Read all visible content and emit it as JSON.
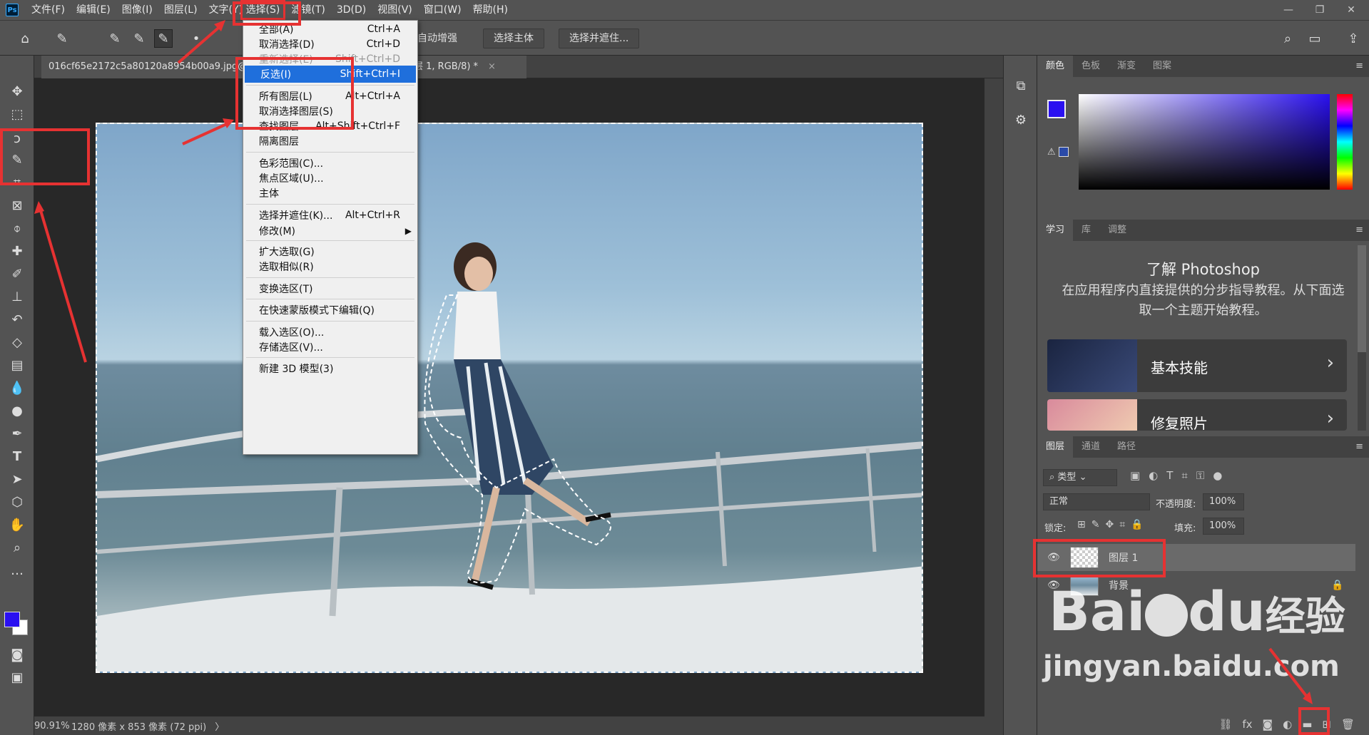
{
  "menubar": {
    "logo": "Ps",
    "items": [
      "文件(F)",
      "编辑(E)",
      "图像(I)",
      "图层(L)",
      "文字(Y)",
      "选择(S)",
      "滤镜(T)",
      "3D(D)",
      "视图(V)",
      "窗口(W)",
      "帮助(H)"
    ],
    "window_controls": [
      "—",
      "❐",
      "✕"
    ]
  },
  "options_bar": {
    "auto_enhance": "自动增强",
    "select_subject": "选择主体",
    "select_and_mask": "选择并遮住..."
  },
  "document": {
    "tab_label": "016cf65e2172c5a80120a8954b00a9.jpg@",
    "tab_suffix": "层 1, RGB/8) *",
    "tab_close": "×"
  },
  "status": {
    "zoom": "90.91%",
    "size": "1280 像素 x 853 像素 (72 ppi)",
    "arrow": "〉"
  },
  "select_menu": {
    "items": [
      {
        "label": "全部(A)",
        "shortcut": "Ctrl+A",
        "state": "normal"
      },
      {
        "label": "取消选择(D)",
        "shortcut": "Ctrl+D",
        "state": "normal"
      },
      {
        "label": "重新选择(E)",
        "shortcut": "Shift+Ctrl+D",
        "state": "disabled"
      },
      {
        "label": "反选(I)",
        "shortcut": "Shift+Ctrl+I",
        "state": "highlighted"
      },
      {
        "label": "所有图层(L)",
        "shortcut": "Alt+Ctrl+A",
        "state": "normal"
      },
      {
        "label": "取消选择图层(S)",
        "shortcut": "",
        "state": "normal"
      },
      {
        "label": "查找图层",
        "shortcut": "Alt+Shift+Ctrl+F",
        "state": "normal"
      },
      {
        "label": "隔离图层",
        "shortcut": "",
        "state": "normal"
      },
      {
        "label": "色彩范围(C)...",
        "shortcut": "",
        "state": "normal"
      },
      {
        "label": "焦点区域(U)...",
        "shortcut": "",
        "state": "normal"
      },
      {
        "label": "主体",
        "shortcut": "",
        "state": "normal"
      },
      {
        "label": "选择并遮住(K)...",
        "shortcut": "Alt+Ctrl+R",
        "state": "normal"
      },
      {
        "label": "修改(M)",
        "shortcut": "",
        "state": "submenu"
      },
      {
        "label": "扩大选取(G)",
        "shortcut": "",
        "state": "normal"
      },
      {
        "label": "选取相似(R)",
        "shortcut": "",
        "state": "normal"
      },
      {
        "label": "变换选区(T)",
        "shortcut": "",
        "state": "normal"
      },
      {
        "label": "在快速蒙版模式下编辑(Q)",
        "shortcut": "",
        "state": "normal"
      },
      {
        "label": "载入选区(O)...",
        "shortcut": "",
        "state": "normal"
      },
      {
        "label": "存储选区(V)...",
        "shortcut": "",
        "state": "normal"
      },
      {
        "label": "新建 3D 模型(3)",
        "shortcut": "",
        "state": "normal"
      }
    ]
  },
  "color_panel": {
    "tabs": [
      "颜色",
      "色板",
      "渐变",
      "图案"
    ],
    "foreground": "#2a10f0",
    "background": "#ffffff"
  },
  "learn_panel": {
    "tabs": [
      "学习",
      "库",
      "调整"
    ],
    "title": "了解 Photoshop",
    "description": "在应用程序内直接提供的分步指导教程。从下面选取一个主题开始教程。",
    "tutorials": [
      "基本技能",
      "修复照片"
    ]
  },
  "layers_panel": {
    "tabs": [
      "图层",
      "通道",
      "路径"
    ],
    "filter_label": "类型",
    "blend_mode": "正常",
    "opacity_label": "不透明度:",
    "opacity_value": "100%",
    "lock_label": "锁定:",
    "fill_label": "填充:",
    "fill_value": "100%",
    "layers": [
      {
        "name": "图层 1",
        "selected": true
      },
      {
        "name": "背景",
        "selected": false
      }
    ]
  },
  "watermark": {
    "brand": "Bai",
    "brand2": "du",
    "cn": "经验",
    "url": "jingyan.baidu.com"
  },
  "colors": {
    "menu_highlight": "#1f6fdc",
    "annotation_red": "#e63232"
  }
}
